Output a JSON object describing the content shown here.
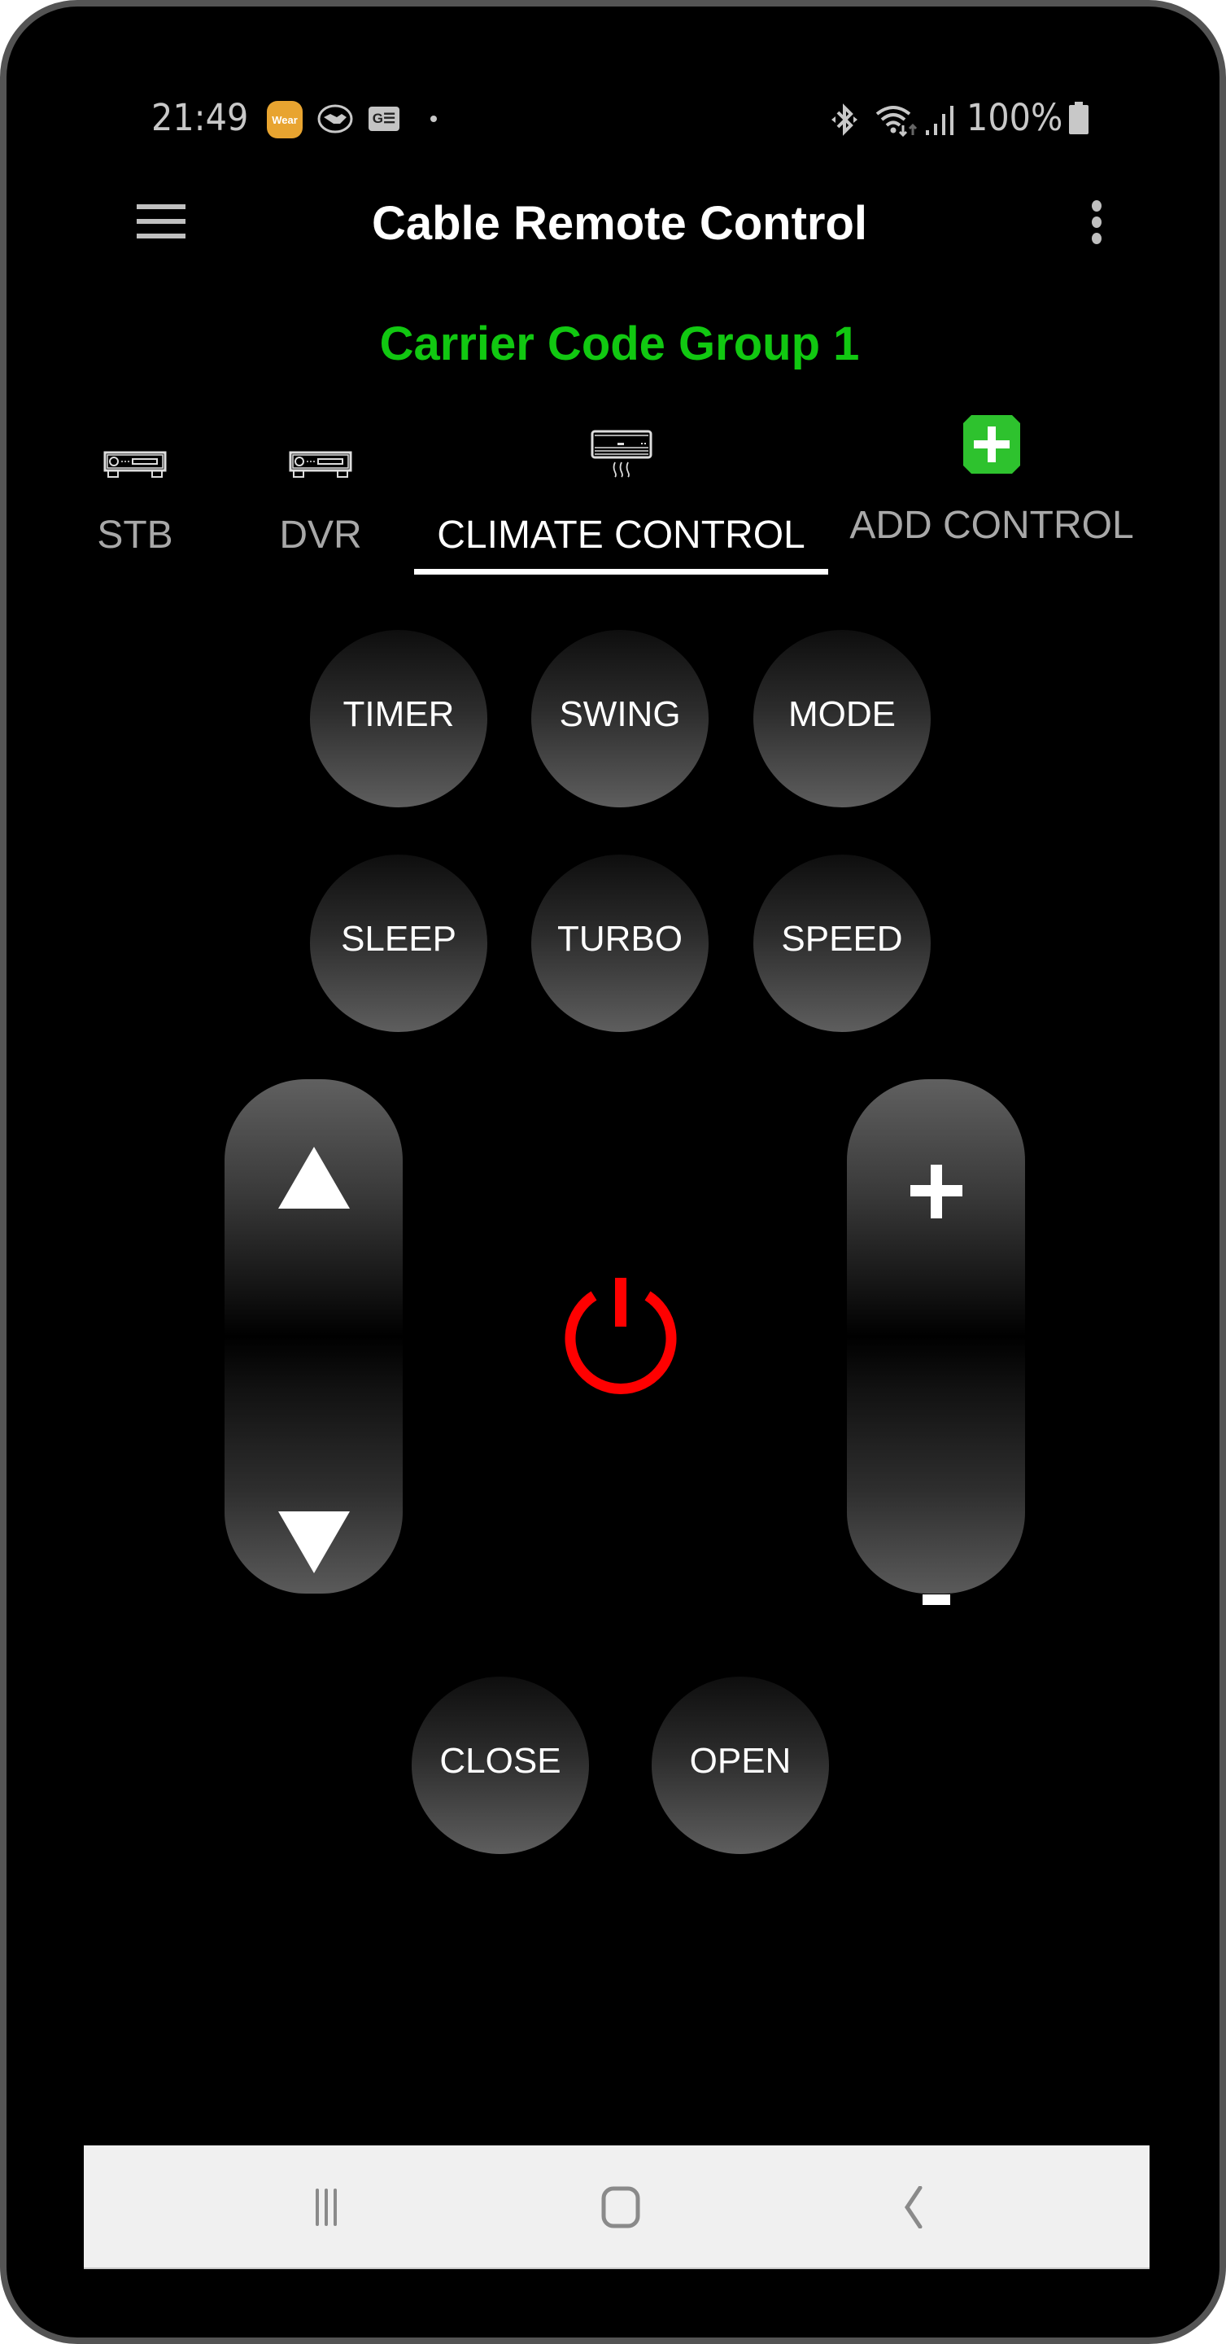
{
  "status_bar": {
    "time": "21:49",
    "notification_icons": [
      "wear-app-icon",
      "handshake-icon",
      "google-news-icon",
      "more-dot-icon"
    ],
    "wear_label": "Wear",
    "news_label": "G☰",
    "system_icons": [
      "bluetooth-icon",
      "wifi-icon",
      "signal-icon",
      "battery-icon"
    ],
    "battery": "100%"
  },
  "app_bar": {
    "title": "Cable Remote Control",
    "menu_icon": "hamburger-menu-icon",
    "overflow_icon": "more-vertical-icon"
  },
  "subtitle": "Carrier Code Group 1",
  "colors": {
    "subtitle": "#11c811",
    "power": "#ff0000",
    "add_control": "#2ec22e"
  },
  "tabs": [
    {
      "label": "STB",
      "icon": "set-top-box-icon",
      "active": false
    },
    {
      "label": "DVR",
      "icon": "dvr-box-icon",
      "active": false
    },
    {
      "label": "CLIMATE CONTROL",
      "icon": "air-conditioner-icon",
      "active": true
    },
    {
      "label": "ADD CONTROL",
      "icon": "add-square-icon",
      "active": false
    }
  ],
  "buttons": {
    "row1": [
      "TIMER",
      "SWING",
      "MODE"
    ],
    "row2": [
      "SLEEP",
      "TURBO",
      "SPEED"
    ],
    "row3": [
      "CLOSE",
      "OPEN"
    ]
  },
  "rockers": {
    "left": {
      "up": "▲",
      "down": "▼",
      "up_name": "temperature-up",
      "down_name": "temperature-down"
    },
    "right": {
      "up": "+",
      "down": "-",
      "up_name": "fan-plus",
      "down_name": "fan-minus"
    }
  },
  "power_icon": "power-icon",
  "nav_bar": [
    "recent-apps-icon",
    "home-icon",
    "back-icon"
  ]
}
